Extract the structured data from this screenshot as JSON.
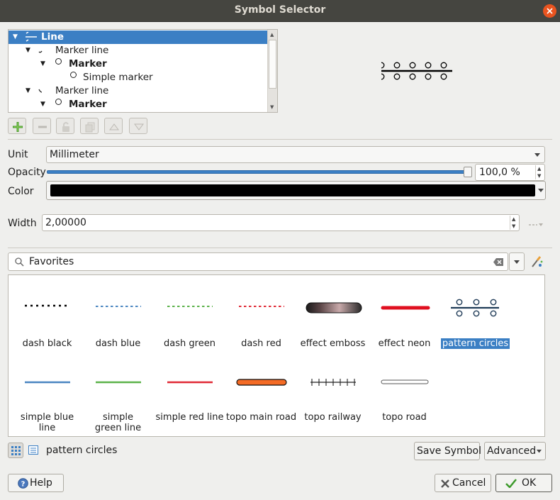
{
  "window": {
    "title": "Symbol Selector"
  },
  "layer_tree": {
    "items": [
      {
        "label": "Line",
        "selected": true
      },
      {
        "label": "Marker line"
      },
      {
        "label": "Marker"
      },
      {
        "label": "Simple marker"
      },
      {
        "label": "Marker line"
      },
      {
        "label": "Marker"
      }
    ]
  },
  "layer_toolbar": {
    "buttons": [
      "add-layer",
      "remove-layer",
      "lock-layer",
      "duplicate-layer",
      "move-up",
      "move-down"
    ]
  },
  "properties": {
    "unit_label": "Unit",
    "unit_value": "Millimeter",
    "opacity_label": "Opacity",
    "opacity_value": "100,0 %",
    "opacity_fraction": 1.0,
    "color_label": "Color",
    "color_value": "#000000",
    "width_label": "Width",
    "width_value": "2,00000"
  },
  "library": {
    "search_value": "Favorites",
    "symbols": [
      {
        "name": "dash  black"
      },
      {
        "name": "dash blue"
      },
      {
        "name": "dash green"
      },
      {
        "name": "dash red"
      },
      {
        "name": "effect emboss"
      },
      {
        "name": "effect neon"
      },
      {
        "name": "pattern circles",
        "selected": true
      },
      {
        "name": "simple blue line"
      },
      {
        "name": "simple green line"
      },
      {
        "name": "simple red line"
      },
      {
        "name": "topo main road"
      },
      {
        "name": "topo railway"
      },
      {
        "name": "topo road"
      }
    ],
    "current_symbol": "pattern circles",
    "save_symbol_label": "Save Symbol",
    "advanced_label": "Advanced"
  },
  "footer": {
    "help_label": "Help",
    "cancel_label": "Cancel",
    "ok_label": "OK"
  },
  "colors": {
    "accent": "#3b7fc4",
    "titlebar": "#454540",
    "close": "#e95420",
    "dash_blue": "#4a86c1",
    "dash_green": "#5cb24a",
    "dash_red": "#e02a36",
    "topo_main_road": "#f46b25"
  }
}
